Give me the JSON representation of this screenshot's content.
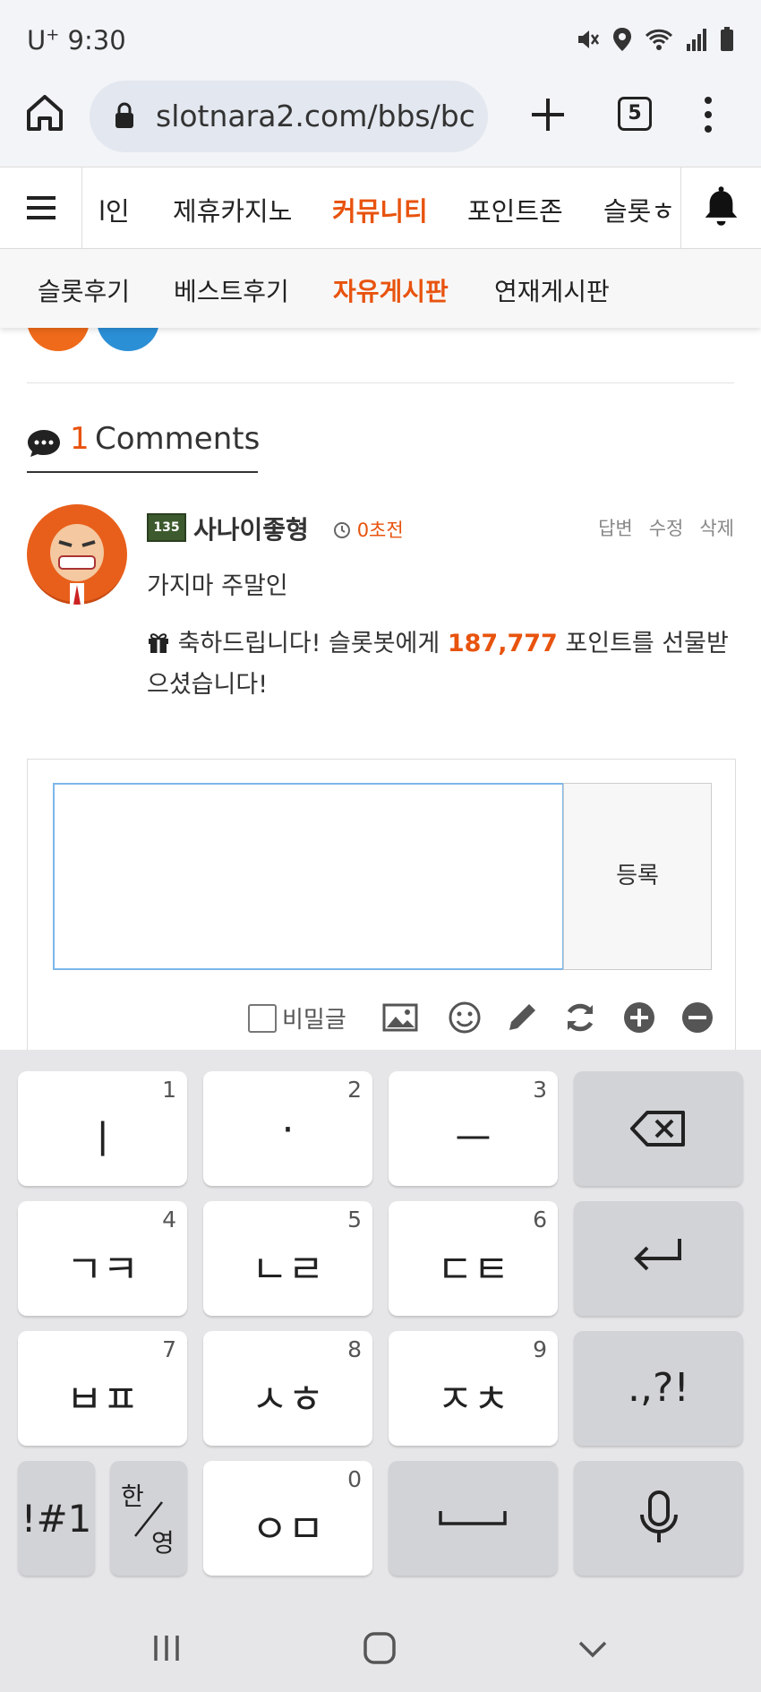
{
  "status_bar": {
    "carrier": "U",
    "carrier_sup": "+",
    "time": "9:30",
    "icons": [
      "mute-icon",
      "location-icon",
      "wifi-icon",
      "signal-icon",
      "battery-icon"
    ]
  },
  "browser": {
    "url": "slotnara2.com/bbs/bc",
    "tab_count": "5"
  },
  "nav": {
    "items": [
      {
        "label": "메인",
        "display": "l인",
        "active": false
      },
      {
        "label": "제휴카지노",
        "active": false
      },
      {
        "label": "커뮤니티",
        "active": true
      },
      {
        "label": "포인트존",
        "active": false
      },
      {
        "label": "슬롯",
        "display": "슬롯ㅎ",
        "active": false
      }
    ]
  },
  "subnav": {
    "items": [
      {
        "label": "슬롯후기",
        "active": false
      },
      {
        "label": "베스트후기",
        "active": false
      },
      {
        "label": "자유게시판",
        "active": true
      },
      {
        "label": "연재게시판",
        "active": false
      }
    ]
  },
  "comments": {
    "count": "1",
    "label": "Comments",
    "items": [
      {
        "level_badge": "135",
        "author": "사나이좋형",
        "time_ago": "0초전",
        "actions": [
          "답변",
          "수정",
          "삭제"
        ],
        "body": "가지마 주말인",
        "gift_prefix": "축하드립니다! 슬롯봇에게 ",
        "gift_points": "187,777",
        "gift_suffix": " 포인트를 선물받으셨습니다!"
      }
    ]
  },
  "comment_form": {
    "textarea_value": "",
    "submit_label": "등록",
    "secret_label": "비밀글",
    "tools": [
      "image-icon",
      "emoji-icon",
      "pencil-icon",
      "refresh-icon",
      "plus-circle-icon",
      "minus-circle-icon"
    ]
  },
  "keyboard": {
    "rows": [
      [
        {
          "glyph": "ㅣ",
          "num": "1"
        },
        {
          "glyph": "·",
          "num": "2"
        },
        {
          "glyph": "ㅡ",
          "num": "3"
        },
        {
          "glyph": "backspace"
        }
      ],
      [
        {
          "glyph": "ㄱㅋ",
          "num": "4"
        },
        {
          "glyph": "ㄴㄹ",
          "num": "5"
        },
        {
          "glyph": "ㄷㅌ",
          "num": "6"
        },
        {
          "glyph": "enter"
        }
      ],
      [
        {
          "glyph": "ㅂㅍ",
          "num": "7"
        },
        {
          "glyph": "ㅅㅎ",
          "num": "8"
        },
        {
          "glyph": "ㅈㅊ",
          "num": "9"
        },
        {
          "glyph": ".,?!"
        }
      ],
      [
        {
          "glyph": "!#1"
        },
        {
          "glyph": "한/영",
          "top": "한",
          "bottom": "영"
        },
        {
          "glyph": "ㅇㅁ",
          "num": "0"
        },
        {
          "glyph": "space"
        },
        {
          "glyph": "mic"
        }
      ]
    ]
  },
  "system_nav": [
    "recents-icon",
    "home-icon",
    "back-icon"
  ]
}
